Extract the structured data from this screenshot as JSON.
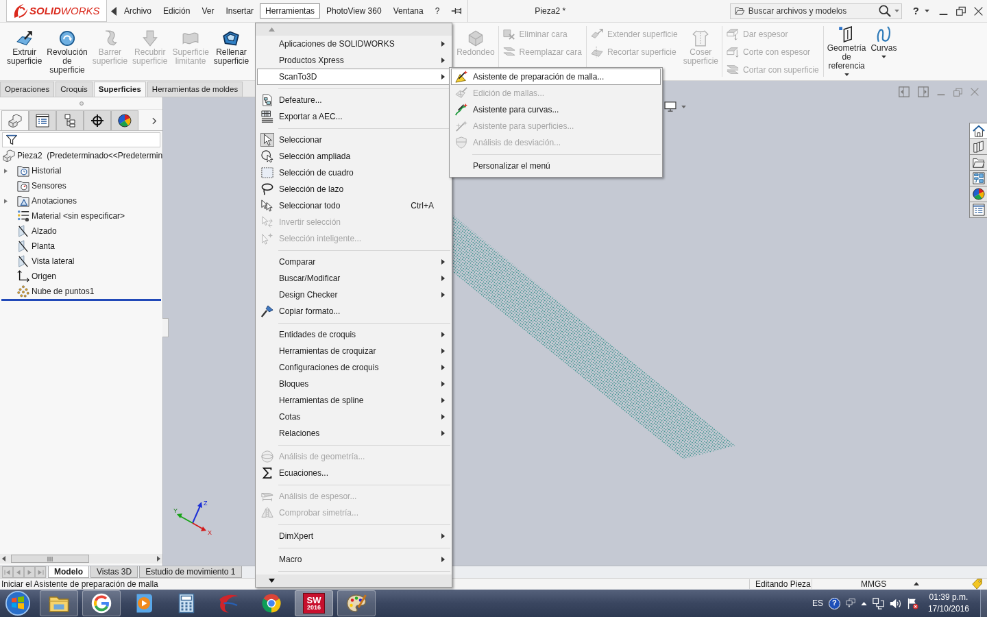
{
  "titlebar": {
    "logo": "**SOLID**WORKS",
    "menus": [
      {
        "label": "Archivo",
        "selected": false
      },
      {
        "label": "Edición",
        "selected": false
      },
      {
        "label": "Ver",
        "selected": false
      },
      {
        "label": "Insertar",
        "selected": false
      },
      {
        "label": "Herramientas",
        "selected": true
      },
      {
        "label": "PhotoView 360",
        "selected": false
      },
      {
        "label": "Ventana",
        "selected": false
      },
      {
        "label": "?",
        "selected": false
      }
    ],
    "title": "Pieza2 *",
    "search": {
      "placeholder": "Buscar archivos y modelos"
    },
    "help": "?"
  },
  "ribbon": {
    "groups": [
      {
        "columns": [
          [
            {
              "kind": "large",
              "label": "Extruir superficie",
              "disabled": false,
              "dropdown": false
            }
          ],
          [
            {
              "kind": "large",
              "label": "Revolución de superficie",
              "disabled": false,
              "dropdown": false
            }
          ],
          [
            {
              "kind": "large",
              "label": "Barrer superficie",
              "disabled": true,
              "dropdown": false
            }
          ],
          [
            {
              "kind": "large",
              "label": "Recubrir superficie",
              "disabled": true,
              "dropdown": false
            }
          ],
          [
            {
              "kind": "large",
              "label": "Superficie limitante",
              "disabled": true,
              "dropdown": false
            }
          ],
          [
            {
              "kind": "large",
              "label": "Rellenar superficie",
              "disabled": false,
              "dropdown": false
            }
          ]
        ]
      },
      {
        "columns": [
          [
            {
              "kind": "large",
              "label": "Redondeo",
              "disabled": true,
              "dropdown": false
            }
          ]
        ]
      },
      {
        "columns": [
          [
            {
              "kind": "small",
              "label": "Eliminar cara",
              "disabled": true
            },
            {
              "kind": "small",
              "label": "Reemplazar cara",
              "disabled": true
            }
          ]
        ]
      },
      {
        "columns": [
          [
            {
              "kind": "small",
              "label": "Extender superficie",
              "disabled": true
            },
            {
              "kind": "small",
              "label": "Recortar superficie",
              "disabled": true
            }
          ],
          [
            {
              "kind": "large",
              "label": "Coser superficie",
              "disabled": true,
              "dropdown": false
            }
          ]
        ]
      },
      {
        "columns": [
          [
            {
              "kind": "small",
              "label": "Dar espesor",
              "disabled": true
            },
            {
              "kind": "small",
              "label": "Corte con espesor",
              "disabled": true
            },
            {
              "kind": "small",
              "label": "Cortar con superficie",
              "disabled": true
            }
          ]
        ]
      },
      {
        "columns": [
          [
            {
              "kind": "large",
              "label": "Geometría de referencia",
              "disabled": false,
              "dropdown": true
            }
          ],
          [
            {
              "kind": "large",
              "label": "Curvas",
              "disabled": false,
              "dropdown": true
            }
          ]
        ]
      }
    ]
  },
  "tools_menu": {
    "sections": [
      [
        {
          "label": "Aplicaciones de SOLIDWORKS",
          "submenu": true,
          "disabled": false,
          "selected": false,
          "checked": false
        },
        {
          "label": "Productos Xpress",
          "submenu": true,
          "disabled": false,
          "selected": false,
          "checked": false
        },
        {
          "label": "ScanTo3D",
          "submenu": true,
          "disabled": false,
          "selected": true,
          "checked": false
        }
      ],
      [
        {
          "label": "Defeature...",
          "submenu": false,
          "disabled": false,
          "selected": false,
          "checked": false
        },
        {
          "label": "Exportar a AEC...",
          "submenu": false,
          "disabled": false,
          "selected": false,
          "checked": false
        }
      ],
      [
        {
          "label": "Seleccionar",
          "submenu": false,
          "disabled": false,
          "selected": false,
          "checked": true
        },
        {
          "label": "Selección ampliada",
          "submenu": false,
          "disabled": false,
          "selected": false,
          "checked": false
        },
        {
          "label": "Selección de cuadro",
          "submenu": false,
          "disabled": false,
          "selected": false,
          "checked": false
        },
        {
          "label": "Selección de lazo",
          "submenu": false,
          "disabled": false,
          "selected": false,
          "checked": false
        },
        {
          "label": "Seleccionar todo",
          "shortcut": "Ctrl+A",
          "submenu": false,
          "disabled": false,
          "selected": false,
          "checked": false
        },
        {
          "label": "Invertir selección",
          "submenu": false,
          "disabled": true,
          "selected": false,
          "checked": false
        },
        {
          "label": "Selección inteligente...",
          "submenu": false,
          "disabled": true,
          "selected": false,
          "checked": false
        }
      ],
      [
        {
          "label": "Comparar",
          "submenu": true,
          "disabled": false,
          "selected": false,
          "checked": false
        },
        {
          "label": "Buscar/Modificar",
          "submenu": true,
          "disabled": false,
          "selected": false,
          "checked": false
        },
        {
          "label": "Design Checker",
          "submenu": true,
          "disabled": false,
          "selected": false,
          "checked": false
        },
        {
          "label": "Copiar formato...",
          "submenu": false,
          "disabled": false,
          "selected": false,
          "checked": false
        }
      ],
      [
        {
          "label": "Entidades de croquis",
          "submenu": true,
          "disabled": false,
          "selected": false,
          "checked": false
        },
        {
          "label": "Herramientas de croquizar",
          "submenu": true,
          "disabled": false,
          "selected": false,
          "checked": false
        },
        {
          "label": "Configuraciones de croquis",
          "submenu": true,
          "disabled": false,
          "selected": false,
          "checked": false
        },
        {
          "label": "Bloques",
          "submenu": true,
          "disabled": false,
          "selected": false,
          "checked": false
        },
        {
          "label": "Herramientas de spline",
          "submenu": true,
          "disabled": false,
          "selected": false,
          "checked": false
        },
        {
          "label": "Cotas",
          "submenu": true,
          "disabled": false,
          "selected": false,
          "checked": false
        },
        {
          "label": "Relaciones",
          "submenu": true,
          "disabled": false,
          "selected": false,
          "checked": false
        }
      ],
      [
        {
          "label": "Análisis de geometría...",
          "submenu": false,
          "disabled": true,
          "selected": false,
          "checked": false
        },
        {
          "label": "Ecuaciones...",
          "submenu": false,
          "disabled": false,
          "selected": false,
          "checked": false
        }
      ],
      [
        {
          "label": "Análisis de espesor...",
          "submenu": false,
          "disabled": true,
          "selected": false,
          "checked": false
        },
        {
          "label": "Comprobar simetría...",
          "submenu": false,
          "disabled": true,
          "selected": false,
          "checked": false
        }
      ],
      [
        {
          "label": "DimXpert",
          "submenu": true,
          "disabled": false,
          "selected": false,
          "checked": false
        }
      ],
      [
        {
          "label": "Macro",
          "submenu": true,
          "disabled": false,
          "selected": false,
          "checked": false
        }
      ]
    ]
  },
  "scan_menu": {
    "sections": [
      [
        {
          "label": "Asistente de preparación de malla...",
          "disabled": false,
          "selected": true
        },
        {
          "label": "Edición de mallas...",
          "disabled": true,
          "selected": false
        },
        {
          "label": "Asistente para curvas...",
          "disabled": false,
          "selected": false
        },
        {
          "label": "Asistente para superficies...",
          "disabled": true,
          "selected": false
        },
        {
          "label": "Análisis de desviación...",
          "disabled": true,
          "selected": false
        }
      ],
      [
        {
          "label": "Personalizar el menú",
          "disabled": false,
          "selected": false
        }
      ]
    ]
  },
  "ribbon_tabs": [
    {
      "label": "Operaciones",
      "selected": false
    },
    {
      "label": "Croquis",
      "selected": false
    },
    {
      "label": "Superficies",
      "selected": true
    },
    {
      "label": "Herramientas de moldes",
      "selected": false
    }
  ],
  "feature_manager": {
    "tabs": [
      {
        "selected": true
      },
      {
        "selected": false
      },
      {
        "selected": false
      },
      {
        "selected": false
      },
      {
        "selected": false
      }
    ],
    "tree": {
      "label": "Pieza2  (Predeterminado<<Predetermin",
      "children": [
        {
          "label": "Historial",
          "expandable": true,
          "expanded": false
        },
        {
          "label": "Sensores",
          "expandable": false
        },
        {
          "label": "Anotaciones",
          "expandable": true,
          "expanded": false
        },
        {
          "label": "Material <sin especificar>",
          "expandable": false
        },
        {
          "label": "Alzado",
          "expandable": false
        },
        {
          "label": "Planta",
          "expandable": false
        },
        {
          "label": "Vista lateral",
          "expandable": false
        },
        {
          "label": "Origen",
          "expandable": false
        },
        {
          "label": "Nube de puntos1",
          "expandable": false
        }
      ]
    }
  },
  "graphics": {
    "triad": [
      "X",
      "Y",
      "Z"
    ],
    "task_pane": [
      {
        "selected": true
      },
      {
        "selected": false
      },
      {
        "selected": false
      },
      {
        "selected": false
      },
      {
        "selected": false
      },
      {
        "selected": false
      }
    ]
  },
  "model_tabs": [
    {
      "label": "Modelo",
      "selected": true
    },
    {
      "label": "Vistas 3D",
      "selected": false
    },
    {
      "label": "Estudio de movimiento 1",
      "selected": false
    }
  ],
  "status_bar": {
    "message": "Iniciar el Asistente de preparación de malla",
    "mode": "Editando Pieza",
    "units": "MMGS"
  },
  "taskbar": {
    "apps": [
      {
        "running": true,
        "active": false
      },
      {
        "running": true,
        "active": false
      },
      {
        "running": false,
        "active": false
      },
      {
        "running": false,
        "active": false
      },
      {
        "running": false,
        "active": false
      },
      {
        "running": false,
        "active": false
      },
      {
        "running": true,
        "active": true,
        "texts": [
          "SW",
          "2016"
        ]
      },
      {
        "running": true,
        "active": false
      }
    ],
    "language": "ES",
    "help": "?",
    "time": "01:39 p.m.",
    "date": "17/10/2016"
  }
}
